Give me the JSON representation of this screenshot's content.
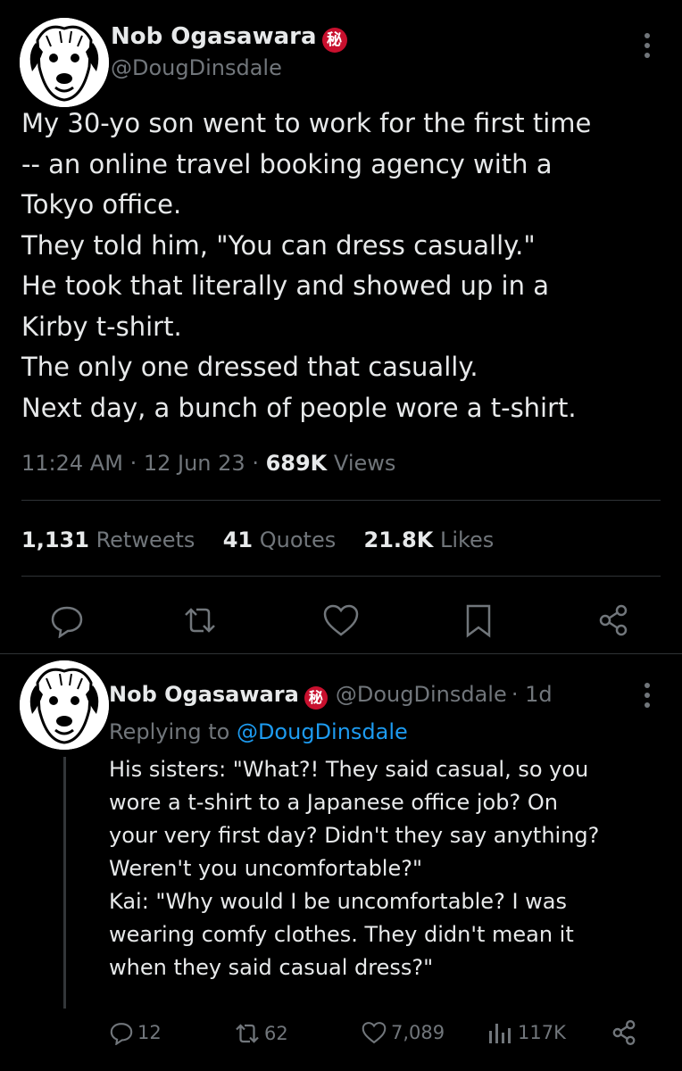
{
  "main_tweet": {
    "author_name": "Nob Ogasawara",
    "badge": "秘",
    "handle": "@DougDinsdale",
    "text": "My 30-yo son went to work for the first time\n-- an online travel booking agency with a\nTokyo office.\nThey told him, \"You can dress casually.\"\nHe took that literally and showed up in a\nKirby t-shirt.\nThe only one dressed that casually.\nNext day, a bunch of people wore a t-shirt.",
    "time": "11:24 AM",
    "date": "12 Jun 23",
    "views_count": "689K",
    "views_label": "Views",
    "retweets_count": "1,131",
    "retweets_label": "Retweets",
    "quotes_count": "41",
    "quotes_label": "Quotes",
    "likes_count": "21.8K",
    "likes_label": "Likes",
    "icons": [
      "reply-icon",
      "retweet-icon",
      "like-icon",
      "bookmark-icon",
      "share-icon"
    ]
  },
  "reply_tweet": {
    "author_name": "Nob Ogasawara",
    "badge": "秘",
    "handle": "@DougDinsdale",
    "age": "· 1d",
    "replying_prefix": "Replying to",
    "replying_handle": "@DougDinsdale",
    "text": "His sisters: \"What?! They said casual, so you\nwore a t-shirt to a Japanese office job? On\nyour very first day? Didn't they say anything?\nWeren't you uncomfortable?\"\nKai: \"Why would I be uncomfortable? I was\nwearing comfy clothes. They didn't mean it\nwhen they said casual dress?\"",
    "replies": "12",
    "retweets": "62",
    "likes": "7,089",
    "views": "117K"
  },
  "colors": {
    "background": "#000000",
    "text": "#e7e9ea",
    "muted": "#71767b",
    "link": "#1d9bf0",
    "badge": "#c8102e"
  }
}
